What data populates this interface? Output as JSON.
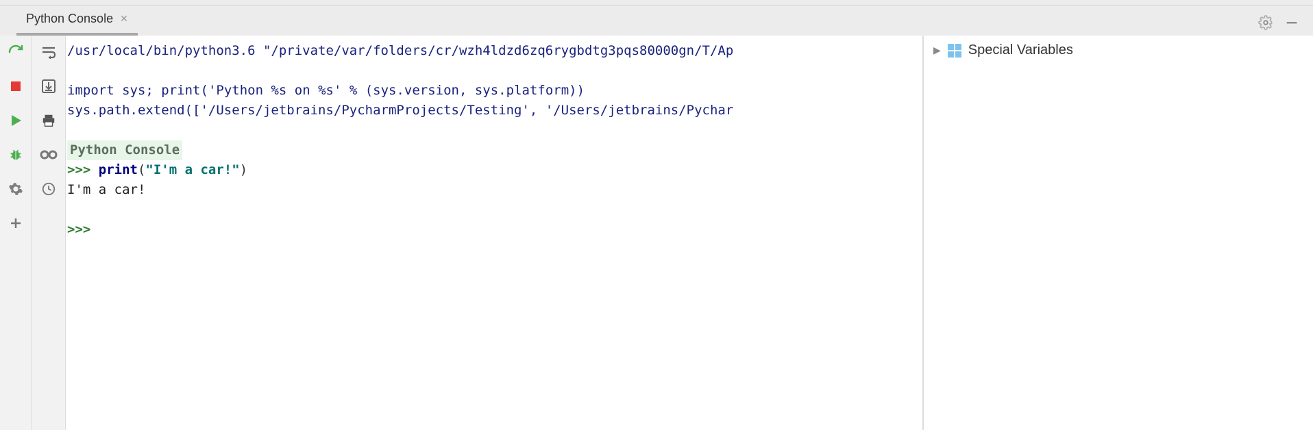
{
  "tab": {
    "title": "Python Console"
  },
  "console": {
    "line1": "/usr/local/bin/python3.6 \"/private/var/folders/cr/wzh4ldzd6zq6rygbdtg3pqs80000gn/T/Ap",
    "line2_a": "import",
    "line2_b": " sys; ",
    "line2_c": "print",
    "line2_d": "(",
    "line2_e": "'Python %s on %s'",
    "line2_f": " % (sys.version, sys.platform))",
    "line3": "sys.path.extend(['/Users/jetbrains/PycharmProjects/Testing', '/Users/jetbrains/Pychar",
    "title_line": "Python Console",
    "prompt1": ">>> ",
    "cmd_a": "print",
    "cmd_b": "(",
    "cmd_c": "\"I'm a car!\"",
    "cmd_d": ")",
    "output1": "I'm a car!",
    "prompt2": ">>> "
  },
  "variables": {
    "special": "Special Variables"
  }
}
